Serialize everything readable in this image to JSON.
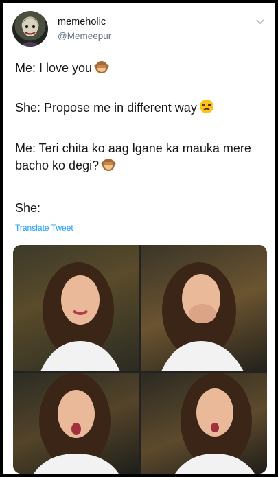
{
  "account": {
    "display_name": "memeholic",
    "handle": "@Memeepur"
  },
  "tweet": {
    "lines": [
      "Me: I love you",
      "She: Propose me in different way",
      "Me: Teri chita ko aag lgane ka mauka mere bacho ko degi?",
      "She:"
    ]
  },
  "translate_label": "Translate Tweet",
  "icons": {
    "menu": "chevron-down-icon",
    "emoji_1": "see-no-evil-monkey-emoji",
    "emoji_2": "unamused-face-emoji",
    "emoji_3": "see-no-evil-monkey-emoji"
  },
  "colors": {
    "link": "#1da1f2",
    "text": "#14171a",
    "secondary": "#657786"
  }
}
